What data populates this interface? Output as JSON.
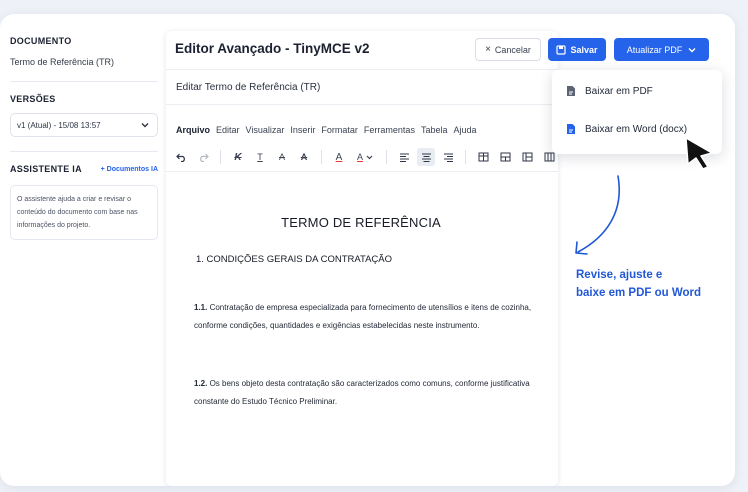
{
  "sidebar": {
    "document_title": "DOCUMENTO",
    "document_name": "Termo de Referência (TR)",
    "versions_title": "VERSÕES",
    "version_selected": "v1 (Atual) - 15/08 13:57",
    "assistant_title": "ASSISTENTE IA",
    "assistant_link": "+ Documentos IA",
    "assistant_text": "O assistente ajuda a criar e revisar o conteúdo do documento com base nas informações do projeto."
  },
  "editor": {
    "title": "Editor Avançado - TinyMCE v2",
    "doc_name": "Editar Termo de Referência (TR)",
    "menu": [
      "Arquivo",
      "Editar",
      "Visualizar",
      "Inserir",
      "Formatar",
      "Ferramentas",
      "Tabela",
      "Ajuda"
    ]
  },
  "buttons": {
    "cancel": "Cancelar",
    "save": "Salvar",
    "update_pdf": "Atualizar PDF"
  },
  "dropdown": {
    "pdf": "Baixar em PDF",
    "word": "Baixar em Word (docx)"
  },
  "document": {
    "title": "TERMO DE REFERÊNCIA",
    "section": "1.   CONDIÇÕES GERAIS DA CONTRATAÇÃO",
    "p1_num": "1.1.",
    "p1": "Contratação de empresa especializada para fornecimento de utensílios e itens de cozinha, conforme condições, quantidades e exigências estabelecidas neste instrumento.",
    "p2_num": "1.2.",
    "p2": "Os bens objeto desta contratação são caracterizados como comuns, conforme justificativa constante do Estudo Técnico Preliminar."
  },
  "annotation": {
    "line1": "Revise, ajuste e",
    "line2": "baixe em PDF ou Word"
  },
  "colors": {
    "accent": "#2563eb",
    "annotation": "#2158d6"
  }
}
